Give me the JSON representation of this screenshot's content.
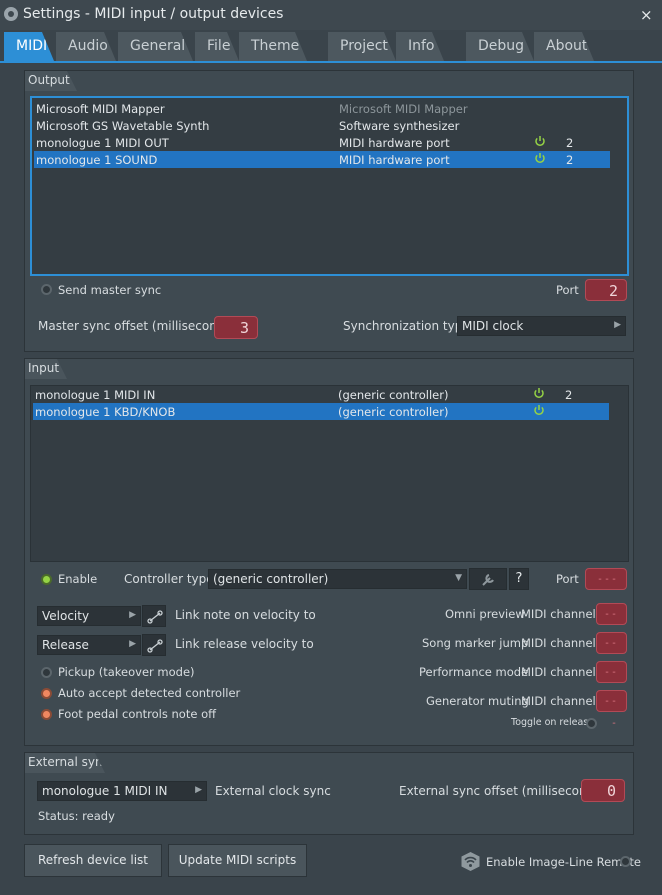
{
  "window": {
    "title": "Settings - MIDI input / output devices",
    "close": "×"
  },
  "tabs": [
    {
      "label": "MIDI"
    },
    {
      "label": "Audio"
    },
    {
      "label": "General"
    },
    {
      "label": "File"
    },
    {
      "label": "Theme"
    },
    {
      "label": "Project"
    },
    {
      "label": "Info"
    },
    {
      "label": "Debug"
    },
    {
      "label": "About"
    }
  ],
  "output": {
    "heading": "Output",
    "devices": [
      {
        "name": "Microsoft MIDI Mapper",
        "type": "Microsoft MIDI Mapper",
        "port": ""
      },
      {
        "name": "Microsoft GS Wavetable Synth",
        "type": "Software synthesizer",
        "port": ""
      },
      {
        "name": "monologue 1 MIDI OUT",
        "type": "MIDI hardware port",
        "port": "2"
      },
      {
        "name": "monologue 1 SOUND",
        "type": "MIDI hardware port",
        "port": "2"
      }
    ],
    "send_master_sync": "Send master sync",
    "port_label": "Port",
    "port_value": "2",
    "master_sync_offset_label": "Master sync offset (milliseconds)",
    "master_sync_offset_value": "3",
    "sync_type_label": "Synchronization type",
    "sync_type_value": "MIDI clock"
  },
  "input": {
    "heading": "Input",
    "devices": [
      {
        "name": "monologue 1 MIDI IN",
        "type": "(generic controller)",
        "port": "2"
      },
      {
        "name": "monologue 1 KBD/KNOB",
        "type": "(generic controller)",
        "port": ""
      }
    ],
    "enable": "Enable",
    "controller_type_label": "Controller type",
    "controller_type_value": "(generic controller)",
    "help": "?",
    "port_label": "Port",
    "velocity_select": "Velocity",
    "link_velocity_label": "Link note on velocity to",
    "release_select": "Release",
    "link_release_label": "Link release velocity to",
    "pickup": "Pickup (takeover mode)",
    "auto_accept": "Auto accept detected controller",
    "foot_pedal": "Foot pedal controls note off",
    "omni_preview": "Omni preview",
    "song_marker_jump": "Song marker jump",
    "performance_mode": "Performance mode",
    "generator_muting": "Generator muting",
    "midi_channel": "MIDI channel",
    "toggle_on_release": "Toggle on release",
    "empty_value": "---"
  },
  "external_sync": {
    "heading": "External sync",
    "device": "monologue 1 MIDI IN",
    "clock_label": "External clock sync",
    "offset_label": "External sync offset (milliseconds)",
    "offset_value": "0",
    "status": "Status: ready"
  },
  "footer": {
    "refresh": "Refresh device list",
    "update_scripts": "Update MIDI scripts",
    "enable_remote": "Enable Image-Line Remote"
  },
  "colors": {
    "accent": "#2d8fd6",
    "power_on": "#95d345",
    "value_box": "#8a2f3a"
  }
}
